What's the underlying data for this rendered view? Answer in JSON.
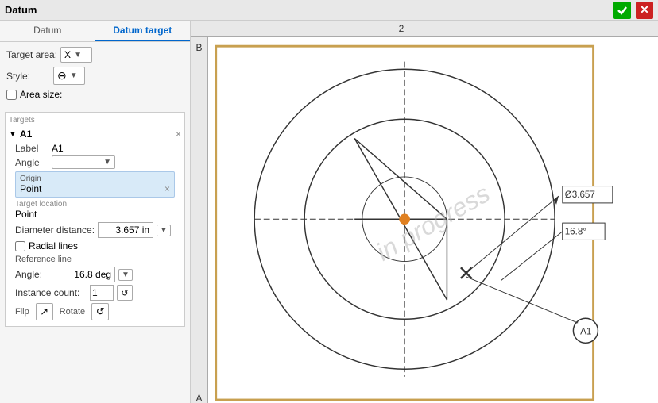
{
  "titleBar": {
    "title": "Datum"
  },
  "tabs": {
    "datum": "Datum",
    "datumTarget": "Datum target"
  },
  "fields": {
    "targetArea": {
      "label": "Target area:",
      "value": "X"
    },
    "style": {
      "label": "Style:",
      "value": "⊖"
    },
    "areaSize": {
      "label": "Area size:"
    }
  },
  "targets": {
    "groupLabel": "Targets",
    "items": [
      {
        "id": "A1",
        "label": "A1",
        "labelField": "Label",
        "labelValue": "A1",
        "angleField": "Angle",
        "origin": {
          "label": "Origin",
          "value": "Point"
        },
        "targetLocation": {
          "label": "Target location",
          "value": "Point"
        },
        "diameterDistance": {
          "label": "Diameter distance:",
          "value": "3.657 in"
        },
        "radialLines": "Radial lines",
        "referenceLine": "Reference line",
        "angle": {
          "label": "Angle:",
          "value": "16.8 deg"
        },
        "instanceCount": {
          "label": "Instance count:",
          "value": "1"
        },
        "flipRotate": {
          "label": "Flip",
          "label2": "Rotate"
        }
      }
    ]
  },
  "drawing": {
    "colHeaders": [
      "",
      "2",
      ""
    ],
    "rowLabels": [
      "B",
      "A"
    ],
    "diameter": "Ø3.657",
    "angle": "16.8°",
    "targetLabel": "A1",
    "watermark": "in progress"
  }
}
